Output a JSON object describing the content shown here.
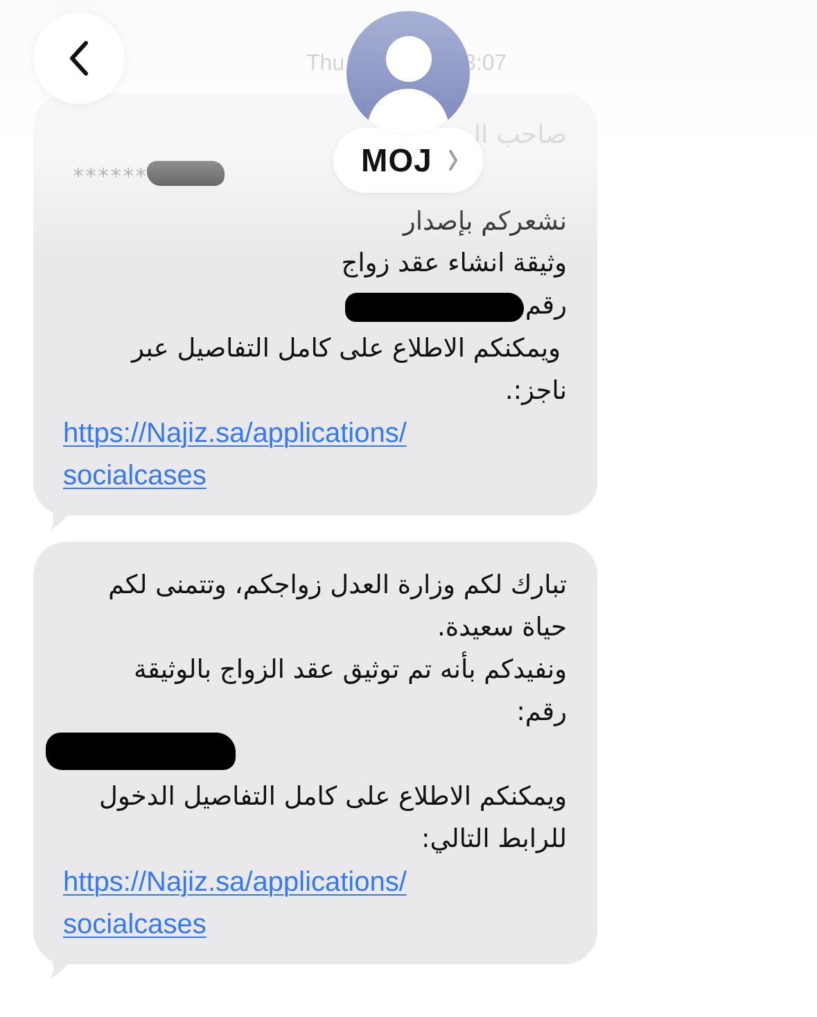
{
  "header": {
    "timestamp_day": "Thu",
    "timestamp_time": "3:07",
    "contact_name": "MOJ",
    "faded_header_text": "صاحب ال"
  },
  "messages": [
    {
      "masked_prefix": "******",
      "lines": [
        "نشعركم بإصدار",
        "وثيقة انشاء عقد زواج",
        "رقم",
        "ويمكنكم الاطلاع على كامل التفاصيل عبر",
        "ناجز:."
      ],
      "link_lines": [
        "https://Najiz.sa/applications/",
        "socialcases"
      ]
    },
    {
      "lines": [
        "تبارك لكم وزارة العدل زواجكم، وتتمنى لكم",
        "حياة سعيدة.",
        "ونفيدكم بأنه تم توثيق عقد الزواج بالوثيقة",
        "رقم:",
        "ويمكنكم الاطلاع على كامل التفاصيل الدخول",
        "للرابط التالي:"
      ],
      "link_lines": [
        "https://Najiz.sa/applications/",
        "socialcases"
      ]
    }
  ],
  "icons": {
    "back": "chevron-left-icon",
    "avatar": "person-avatar-icon",
    "contact_chevron": "chevron-right-icon"
  }
}
